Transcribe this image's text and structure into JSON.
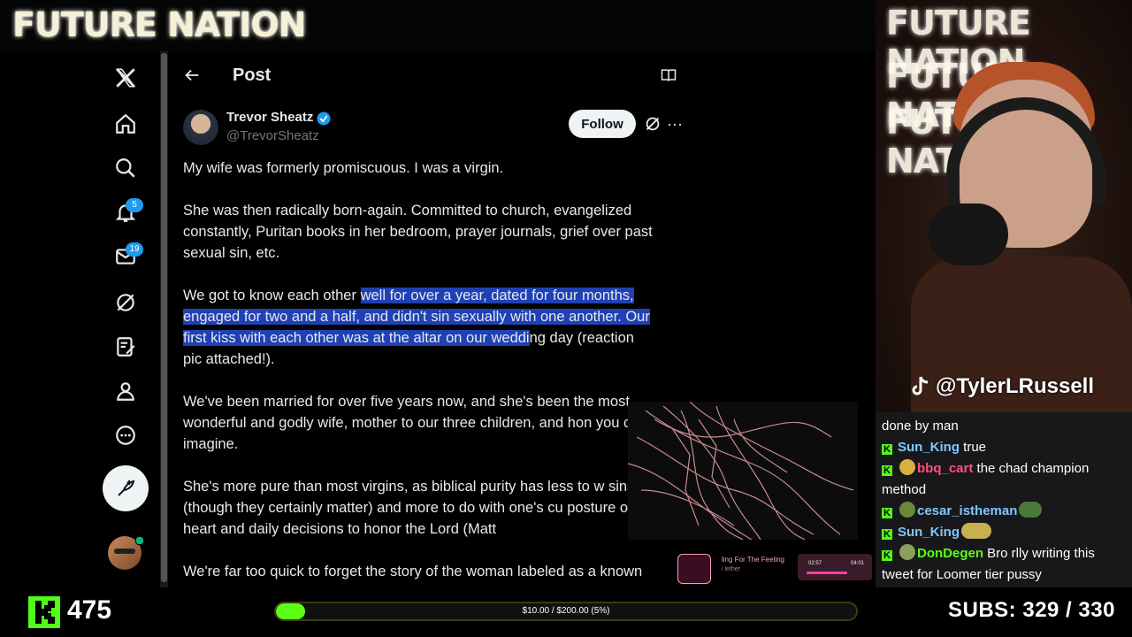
{
  "banner": {
    "logo_text": "FUTURE NATION"
  },
  "nav": {
    "notifications_badge": "5",
    "messages_badge": "19"
  },
  "post": {
    "header_title": "Post",
    "author_name": "Trevor Sheatz",
    "author_handle": "@TrevorSheatz",
    "follow_label": "Follow",
    "more_label": "···",
    "p1": "My wife was formerly promiscuous. I was a virgin.",
    "p2": "She was then radically born-again. Committed to church, evangelized constantly, Puritan books in her bedroom, prayer journals, grief over past sexual sin, etc.",
    "p3_plain": "We got to know each other ",
    "p3_hl1": "well for over a year, dated for four months,",
    "p3_hl2": "engaged for two and a half, and didn't sin sexually with one another. Our",
    "p3_hl3": "first kiss with each other was at the altar on our weddi",
    "p3_tail": "ng day (reaction",
    "p3_end": "pic attached!).",
    "p4": "We've been married for over five years now, and she's been the most wonderful and godly wife, mother to our three children, and hon you could imagine.",
    "p5": "She's more pure than most virgins, as biblical purity has less to w sins (though they certainly matter) and more to do with one's cu posture of the heart and daily decisions to honor the Lord (Matt",
    "p6": "We're far too quick to forget the story of the woman labeled as a known"
  },
  "webcam": {
    "overlay_lines": [
      "FUTURE NATION",
      "FUTURE NATION",
      "FUTURE NATION"
    ],
    "tiktok_handle": "@TylerLRussell"
  },
  "chat": {
    "messages": [
      {
        "user": "",
        "text": "done by man",
        "color": "#ffffff"
      },
      {
        "user": "Sun_King",
        "text": "true",
        "color": "#7ec8ff"
      },
      {
        "user": "bbq_cart",
        "text": "the chad champion method",
        "color": "#ff4f7a"
      },
      {
        "user": "cesar_istheman",
        "text": "",
        "color": "#7ec8ff"
      },
      {
        "user": "Sun_King",
        "text": "",
        "color": "#7ec8ff"
      },
      {
        "user": "DonDegen",
        "text": "Bro rlly writing this tweet for Loomer tier pussy",
        "color": "#59ff14"
      }
    ]
  },
  "music": {
    "title": "ling For The Feeling",
    "artist": "i lether",
    "time_elapsed": "02:57",
    "time_total": "04:01",
    "progress": 0.72
  },
  "bottom": {
    "kick_count": "475",
    "goal_text": "$10.00 / $200.00 (5%)",
    "goal_fraction": 0.05,
    "subs_text": "SUBS:  329 / 330"
  },
  "colors": {
    "accent": "#1d9bf0",
    "kick_green": "#53fc18",
    "highlight": "#1f41b5"
  }
}
